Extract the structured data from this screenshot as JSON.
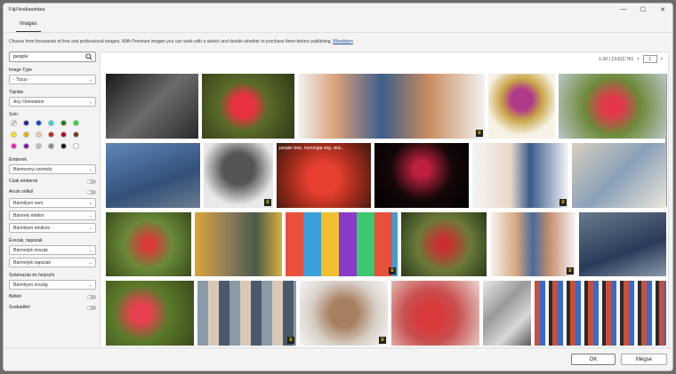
{
  "window": {
    "title": "Fájl kiválasztása"
  },
  "tabs": [
    {
      "label": "Images"
    }
  ],
  "info": {
    "text": "Choose from thousands of free and professional images. With Premium images you can work with a sketch and decide whether to purchase them before publishing.",
    "link": "Bővebben"
  },
  "search": {
    "value": "people"
  },
  "filters": {
    "image_type": {
      "label": "Image Type",
      "value": "- Típus -"
    },
    "orientation": {
      "label": "Tájolás",
      "value": "Any Orientation"
    },
    "color": {
      "label": "Szín",
      "swatches": [
        "#ffffff",
        "#1f2d8c",
        "#1340d8",
        "#2ad7e8",
        "#127a25",
        "#22d63a",
        "#f5e20a",
        "#f0b400",
        "#f3c9a8",
        "#cc1a1a",
        "#b3001b",
        "#6b3a1f",
        "#f01fa8",
        "#7d1aa8",
        "#c0c0c0",
        "#8a8a8a",
        "#111111",
        "#ffffff"
      ]
    },
    "people_label": "Emberek",
    "people_count": "Bármennyi személy",
    "only_people": "Csak emberek",
    "no_faces": "Arcok nélkül",
    "gender": "Bármilyen nem",
    "age": "Bármely életkor",
    "ethnicity": "Bármilyen etnikum",
    "season_label": "Évszak, napszak",
    "season": "Bármelyik évszak",
    "daytime": "Bármelyik napszak",
    "origin_label": "Származás és helyszín",
    "country": "Bármilyen ország",
    "indoor": "Beltéri",
    "outdoor": "Szabadtéri"
  },
  "pager": {
    "range": "1-30 / 13.612.761",
    "page": "1"
  },
  "tiles": [
    {
      "bg": "linear-gradient(135deg,#1a1a1a,#6b6b6b 50%,#2a2a2a)",
      "crown": false
    },
    {
      "bg": "radial-gradient(circle at 45% 50%,#e8323f 0 18%,#5a6b2a 40%,#2e3a17)",
      "crown": false
    },
    {
      "bg": "linear-gradient(90deg,#f2f2f2,#d9a27a 20%,#3d5e8a 45%,#c98c5e 70%,#f2f2f2)",
      "crown": true
    },
    {
      "bg": "radial-gradient(circle at 50% 40%,#b03a8a 0 20%,#c8a548 40%,#f7f2e6 70%)",
      "crown": false
    },
    {
      "bg": "radial-gradient(circle at 50% 50%,#e2384a 0 15%,#6d8a3a 45%,#b8c8c8)",
      "crown": false
    },
    {
      "bg": "linear-gradient(160deg,#5f88b8,#33507a 60%,#6b7c8e)",
      "crown": false
    },
    {
      "bg": "radial-gradient(circle at 50% 40%,#555 0 30%,#e8e8e8 70%)",
      "crown": true
    },
    {
      "bg": "radial-gradient(circle at 50% 55%,#e84030 0 25%,#9a2a1a 60%,#3a1a10)",
      "crown": false,
      "caption": "people tree, myrongia vég, virá..."
    },
    {
      "bg": "radial-gradient(circle at 50% 40%,#c02040 0 12%,#150808 50%,#000)",
      "crown": false
    },
    {
      "bg": "linear-gradient(90deg,#f5f5f5,#e8d8c8 40%,#3a5a8a 60%,#f5f5f5)",
      "crown": true
    },
    {
      "bg": "linear-gradient(135deg,#d8cfc2,#8aa0b8 50%,#ece6dc)",
      "crown": false
    },
    {
      "bg": "radial-gradient(circle at 50% 50%,#d83a3a 0 10%,#6a8a3a 45%,#3a4a1a)",
      "crown": false
    },
    {
      "bg": "linear-gradient(90deg,#d8a63a,#8a7a5a 40%,#4a5a4a 70%,#d8b040)",
      "crown": false
    },
    {
      "bg": "repeating-linear-gradient(90deg,#e8503a 0 20px,#3aa0d8 20px 40px,#f0c030 40px 60px,#8a3ac8 60px 80px,#3ac870 80px 100px)",
      "crown": true
    },
    {
      "bg": "radial-gradient(circle at 50% 50%,#c83030 0 12%,#6a7a3a 50%,#2a3a1a)",
      "crown": false
    },
    {
      "bg": "linear-gradient(90deg,#f5f5f5,#d8a880 30%,#4a6a9a 50%,#c89070 70%,#f5f5f5)",
      "crown": true
    },
    {
      "bg": "linear-gradient(160deg,#6a7a8a,#2a3a5a 60%,#8a9aa8)",
      "crown": false
    },
    {
      "bg": "radial-gradient(circle at 40% 50%,#e84050 0 15%,#5a7a2a 45%,#3a4a1a)",
      "crown": false
    },
    {
      "bg": "repeating-linear-gradient(90deg,#8a9aa8 0 12px,#d8c8b8 12px 24px,#4a5a6a 24px 36px)",
      "crown": true
    },
    {
      "bg": "radial-gradient(circle at 50% 50%,#a88060 0 25%,#d8d0c8 60%,#f5f5f5)",
      "crown": true
    },
    {
      "bg": "radial-gradient(circle at 45% 55%,#d83a3a 0 20%,#c85050 45%,#e8d8d0)",
      "crown": false
    },
    {
      "bg": "linear-gradient(135deg,#e8e8e8,#9a9a9a 40%,#d8d8d8 70%,#5a5a5a)",
      "crown": false
    },
    {
      "bg": "repeating-linear-gradient(90deg,#c8503a 0 6px,#3a6ac8 6px 12px,#f5f5f5 12px 16px,#2a2a2a 16px 20px)",
      "crown": false
    }
  ],
  "buttons": {
    "ok": "OK",
    "cancel": "Mégse"
  }
}
